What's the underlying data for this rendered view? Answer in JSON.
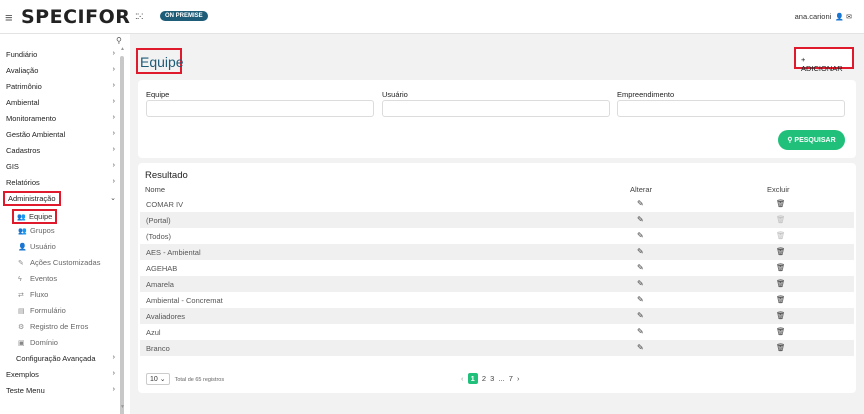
{
  "header": {
    "menu_icon": "hamburger-icon",
    "brand": "SPECIFOR",
    "brand_dots": "::·:",
    "badge": "ON PREMISE",
    "user": "ana.carioni"
  },
  "sidebar": {
    "items": [
      {
        "label": "Fundiário"
      },
      {
        "label": "Avaliação"
      },
      {
        "label": "Patrimônio"
      },
      {
        "label": "Ambiental"
      },
      {
        "label": "Monitoramento"
      },
      {
        "label": "Gestão Ambiental"
      },
      {
        "label": "Cadastros"
      },
      {
        "label": "GIS"
      },
      {
        "label": "Relatórios"
      },
      {
        "label": "Administração"
      }
    ],
    "sub_items": [
      {
        "label": "Equipe",
        "icon": "team-icon"
      },
      {
        "label": "Grupos",
        "icon": "groups-icon"
      },
      {
        "label": "Usuário",
        "icon": "user-icon"
      },
      {
        "label": "Ações Customizadas",
        "icon": "custom-actions-icon"
      },
      {
        "label": "Eventos",
        "icon": "lightning-icon"
      },
      {
        "label": "Fluxo",
        "icon": "flow-icon"
      },
      {
        "label": "Formulário",
        "icon": "form-icon"
      },
      {
        "label": "Registro de Erros",
        "icon": "error-log-icon"
      },
      {
        "label": "Domínio",
        "icon": "domain-icon"
      }
    ],
    "config": "Configuração Avançada",
    "extra": [
      {
        "label": "Exemplos"
      },
      {
        "label": "Teste Menu"
      }
    ]
  },
  "page": {
    "title": "Equipe",
    "add_button": "+ ADICIONAR"
  },
  "filters": {
    "equipe_label": "Equipe",
    "usuario_label": "Usuário",
    "empreendimento_label": "Empreendimento",
    "search_button": "PESQUISAR"
  },
  "results": {
    "title": "Resultado",
    "col_name": "Nome",
    "col_alterar": "Alterar",
    "col_excluir": "Excluir",
    "rows": [
      {
        "name": "COMAR IV",
        "delete_enabled": true
      },
      {
        "name": "(Portal)",
        "delete_enabled": false
      },
      {
        "name": "(Todos)",
        "delete_enabled": false
      },
      {
        "name": "AES - Ambiental",
        "delete_enabled": true
      },
      {
        "name": "AGEHAB",
        "delete_enabled": true
      },
      {
        "name": "Amarela",
        "delete_enabled": true
      },
      {
        "name": "Ambiental - Concremat",
        "delete_enabled": true
      },
      {
        "name": "Avaliadores",
        "delete_enabled": true
      },
      {
        "name": "Azul",
        "delete_enabled": true
      },
      {
        "name": "Branco",
        "delete_enabled": true
      }
    ],
    "page_size": "10",
    "total": "Total de 65 registros",
    "pages": [
      "1",
      "2",
      "3",
      "...",
      "7"
    ],
    "current_page": "1"
  },
  "colors": {
    "accent_green": "#21c07a",
    "title_blue": "#1f5c78",
    "highlight_red": "#e01a2d"
  }
}
